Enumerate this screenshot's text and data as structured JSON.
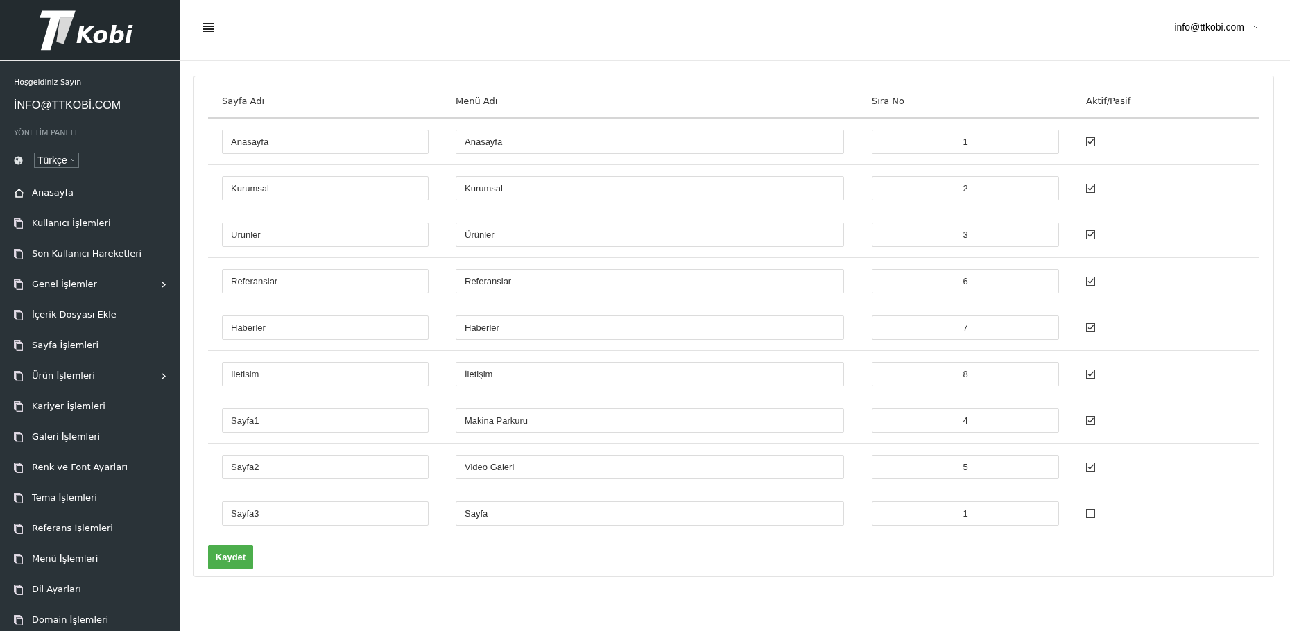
{
  "sidebar": {
    "logo_text": "Kobi",
    "welcome": "Hoşgeldiniz Sayın",
    "user": "İNFO@TTKOBİ.COM",
    "section": "YÖNETİM PANELI",
    "language": "Türkçe",
    "items": [
      {
        "label": "Anasayfa",
        "kind": "home",
        "submenu": false
      },
      {
        "label": "Kullanıcı İşlemleri",
        "kind": "pages",
        "submenu": false
      },
      {
        "label": "Son Kullanıcı Hareketleri",
        "kind": "pages",
        "submenu": false
      },
      {
        "label": "Genel İşlemler",
        "kind": "pages",
        "submenu": true
      },
      {
        "label": "İçerik Dosyası Ekle",
        "kind": "pages",
        "submenu": false
      },
      {
        "label": "Sayfa İşlemleri",
        "kind": "pages",
        "submenu": false
      },
      {
        "label": "Ürün İşlemleri",
        "kind": "pages",
        "submenu": true
      },
      {
        "label": "Kariyer İşlemleri",
        "kind": "pages",
        "submenu": false
      },
      {
        "label": "Galeri İşlemleri",
        "kind": "pages",
        "submenu": false
      },
      {
        "label": "Renk ve Font Ayarları",
        "kind": "pages",
        "submenu": false
      },
      {
        "label": "Tema İşlemleri",
        "kind": "pages",
        "submenu": false
      },
      {
        "label": "Referans İşlemleri",
        "kind": "pages",
        "submenu": false
      },
      {
        "label": "Menü İşlemleri",
        "kind": "pages",
        "submenu": false
      },
      {
        "label": "Dil Ayarları",
        "kind": "pages",
        "submenu": false
      },
      {
        "label": "Domain İşlemleri",
        "kind": "pages",
        "submenu": false
      }
    ]
  },
  "header": {
    "user_menu": "info@ttkobi.com"
  },
  "table": {
    "columns": [
      "Sayfa Adı",
      "Menü Adı",
      "Sıra No",
      "Aktif/Pasif"
    ],
    "rows": [
      {
        "page": "Anasayfa",
        "menu": "Anasayfa",
        "order": "1",
        "checked": true
      },
      {
        "page": "Kurumsal",
        "menu": "Kurumsal",
        "order": "2",
        "checked": true
      },
      {
        "page": "Urunler",
        "menu": "Ürünler",
        "order": "3",
        "checked": true
      },
      {
        "page": "Referanslar",
        "menu": "Referanslar",
        "order": "6",
        "checked": true
      },
      {
        "page": "Haberler",
        "menu": "Haberler",
        "order": "7",
        "checked": true
      },
      {
        "page": "Iletisim",
        "menu": "İletişim",
        "order": "8",
        "checked": true
      },
      {
        "page": "Sayfa1",
        "menu": "Makina Parkuru",
        "order": "4",
        "checked": true
      },
      {
        "page": "Sayfa2",
        "menu": "Video Galeri",
        "order": "5",
        "checked": true
      },
      {
        "page": "Sayfa3",
        "menu": "Sayfa",
        "order": "1",
        "checked": false
      }
    ]
  },
  "save_button": "Kaydet"
}
